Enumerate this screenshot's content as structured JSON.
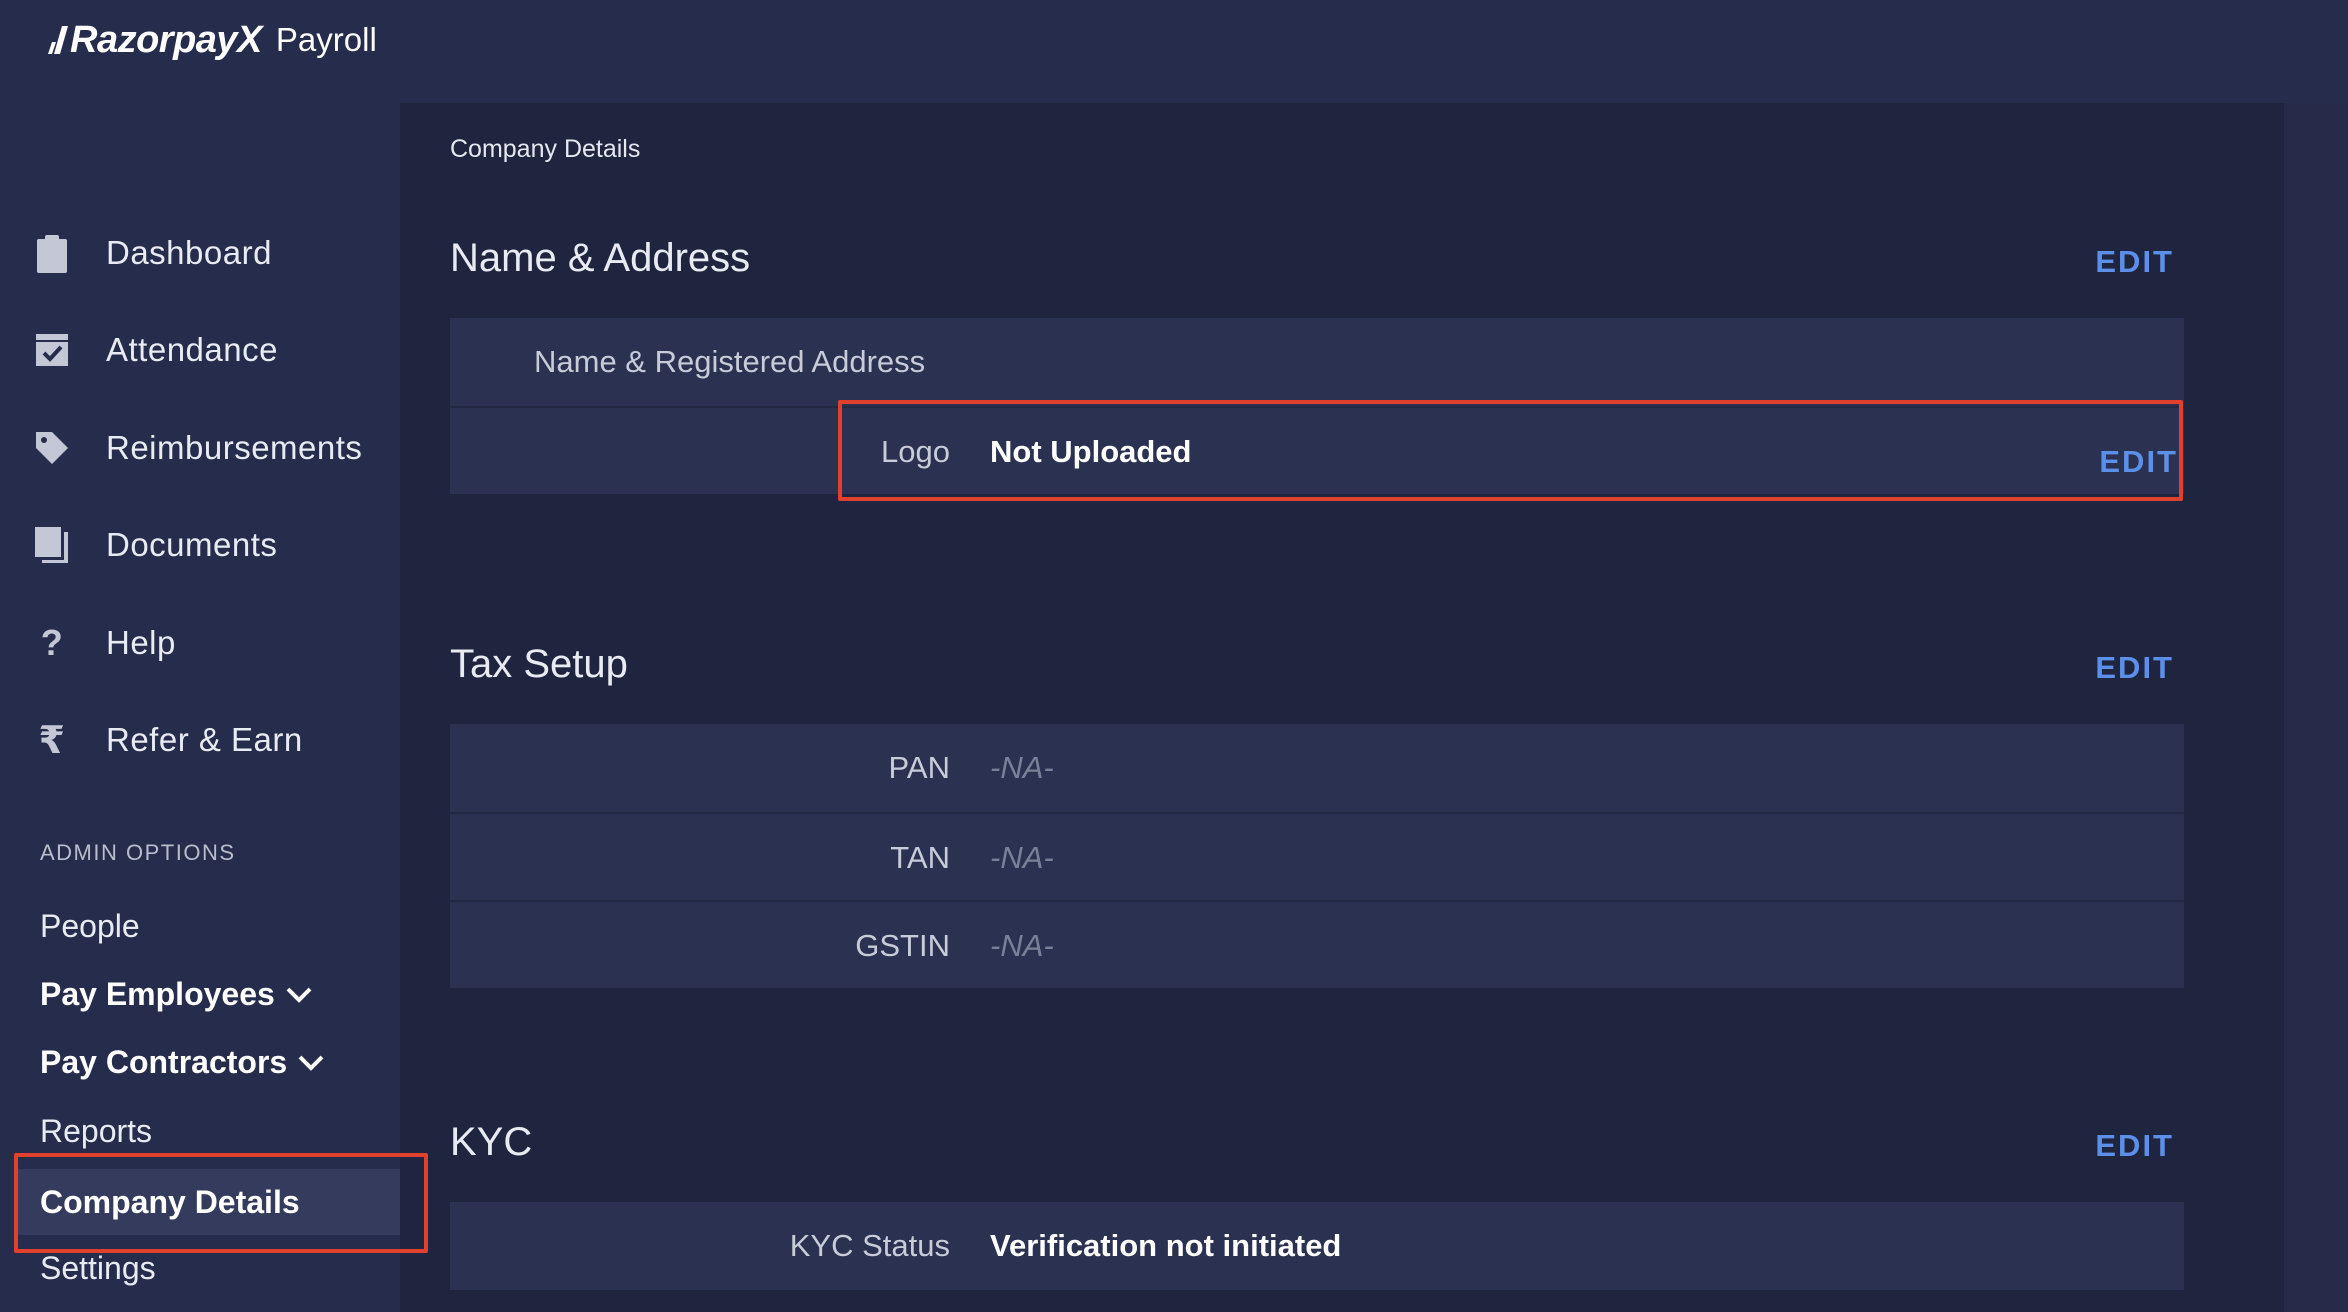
{
  "brand": {
    "name": "RazorpayX",
    "product": "Payroll"
  },
  "sidebar": {
    "nav": [
      {
        "label": "Dashboard",
        "icon": "clipboard-icon"
      },
      {
        "label": "Attendance",
        "icon": "calendar-check-icon"
      },
      {
        "label": "Reimbursements",
        "icon": "tag-icon"
      },
      {
        "label": "Documents",
        "icon": "documents-icon"
      },
      {
        "label": "Help",
        "icon": "help-icon"
      },
      {
        "label": "Refer & Earn",
        "icon": "rupee-icon"
      }
    ],
    "admin_label": "ADMIN OPTIONS",
    "admin": [
      {
        "label": "People"
      },
      {
        "label": "Pay Employees"
      },
      {
        "label": "Pay Contractors"
      },
      {
        "label": "Reports"
      },
      {
        "label": "Company Details"
      },
      {
        "label": "Settings"
      }
    ]
  },
  "main": {
    "breadcrumb": "Company Details",
    "name_address": {
      "title": "Name & Address",
      "edit": "EDIT",
      "registered_label": "Name & Registered Address",
      "logo_label": "Logo",
      "logo_value": "Not Uploaded",
      "logo_edit": "EDIT"
    },
    "tax": {
      "title": "Tax Setup",
      "edit": "EDIT",
      "rows": [
        {
          "label": "PAN",
          "value": "-NA-"
        },
        {
          "label": "TAN",
          "value": "-NA-"
        },
        {
          "label": "GSTIN",
          "value": "-NA-"
        }
      ]
    },
    "kyc": {
      "title": "KYC",
      "edit": "EDIT",
      "status_label": "KYC Status",
      "status_value": "Verification not initiated"
    }
  },
  "colors": {
    "accent": "#5b8fe8",
    "highlight": "#e0402c",
    "background": "#222843"
  }
}
